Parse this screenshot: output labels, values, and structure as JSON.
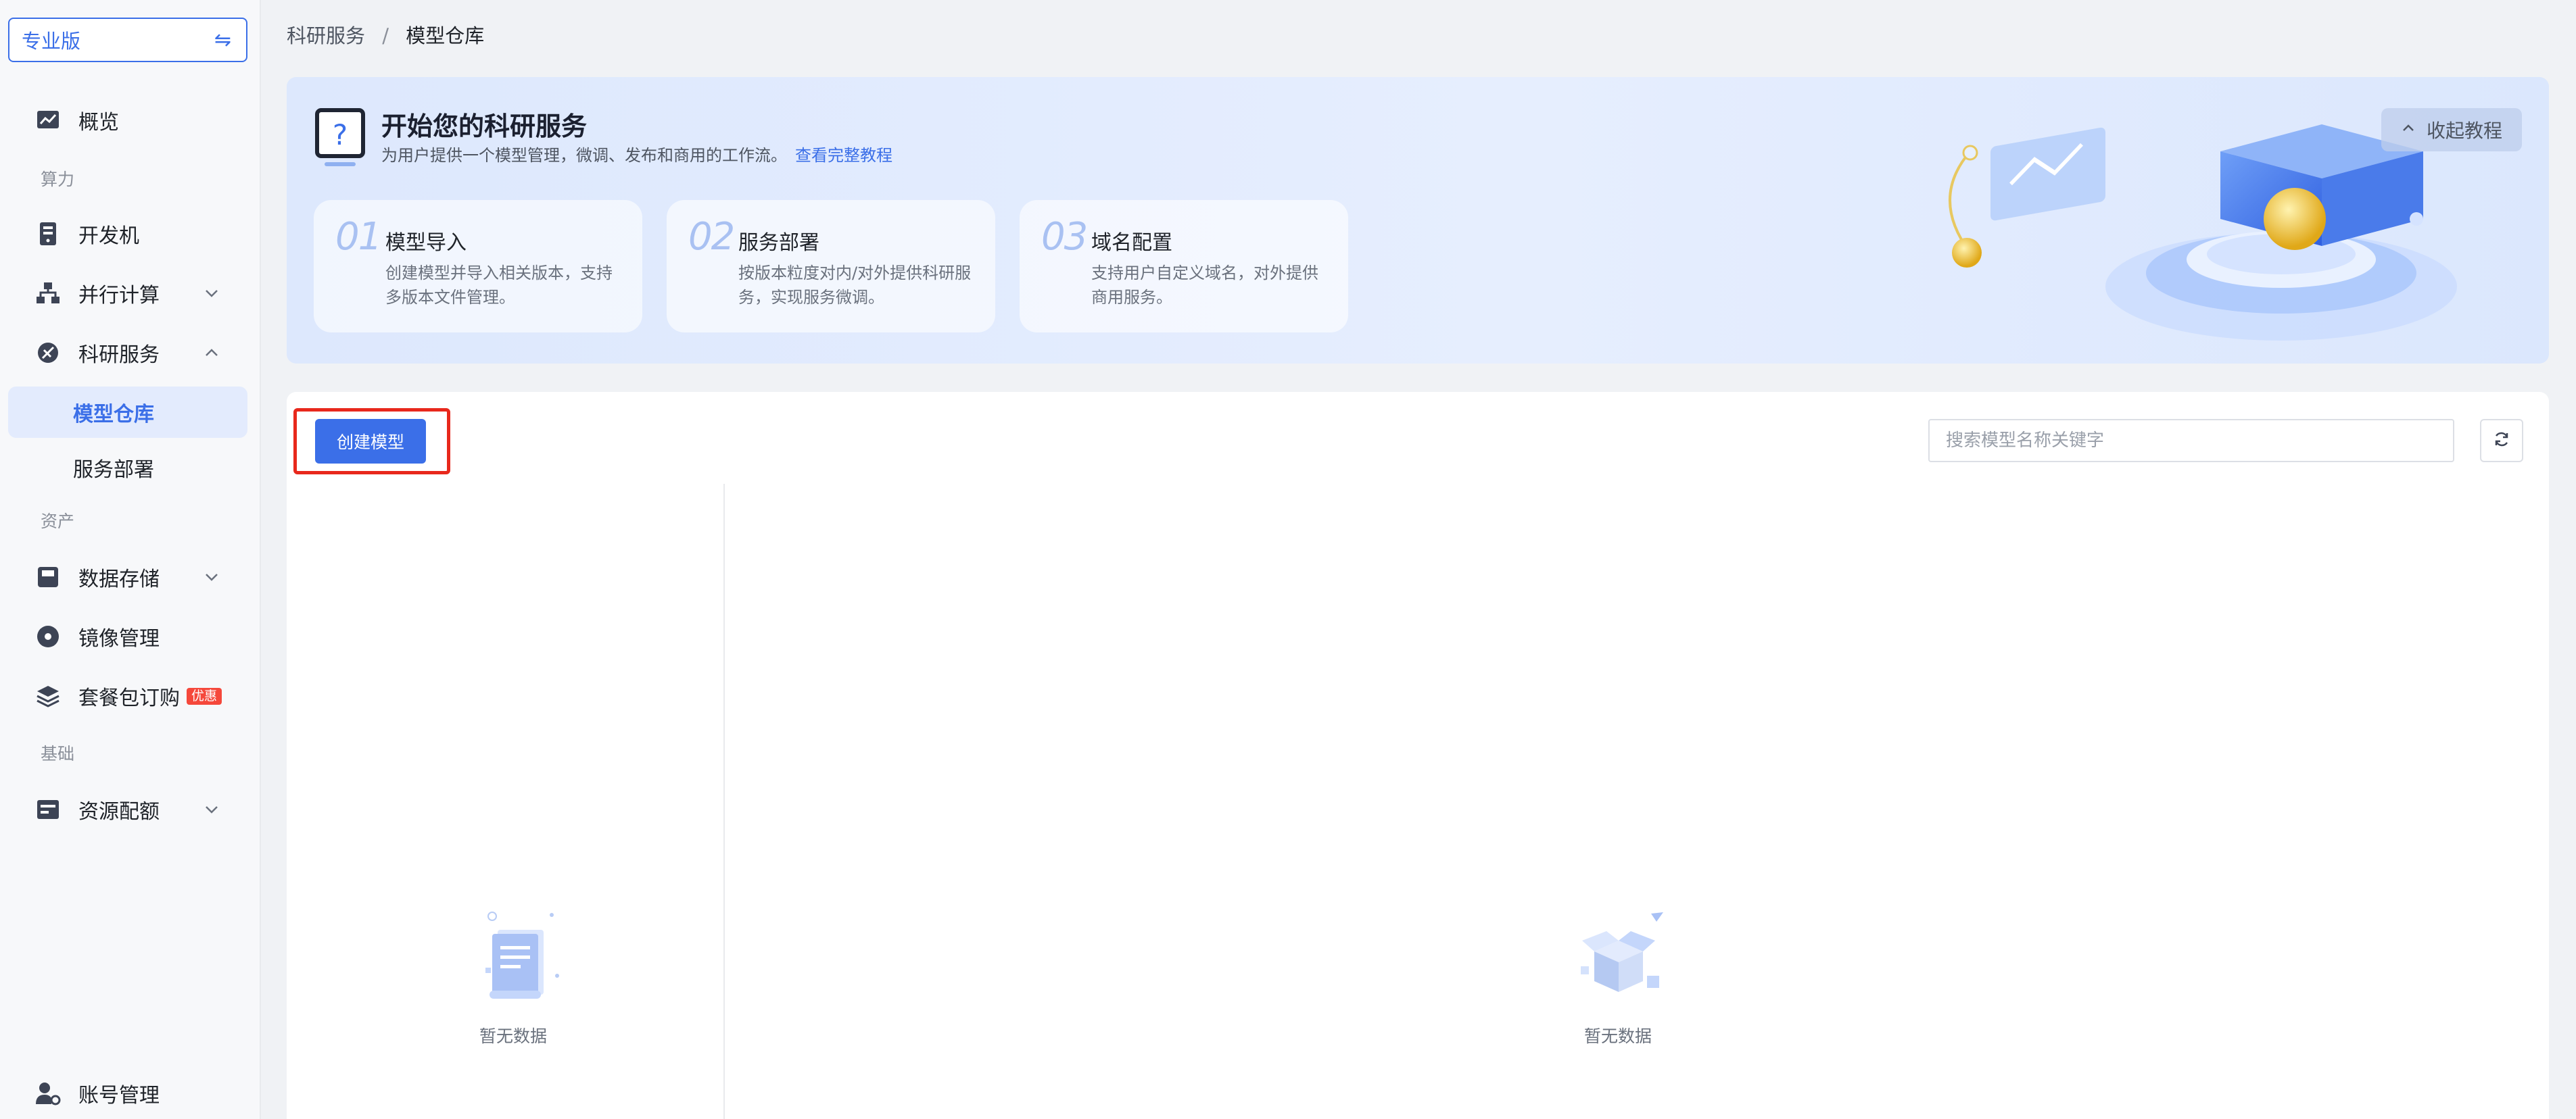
{
  "sidebar": {
    "edition": "专业版",
    "overview": "概览",
    "section_compute": "算力",
    "devmachine": "开发机",
    "parallel": "并行计算",
    "research": "科研服务",
    "model_repo": "模型仓库",
    "service_deploy": "服务部署",
    "section_assets": "资产",
    "data_storage": "数据存储",
    "image_mgmt": "镜像管理",
    "package_order": "套餐包订购",
    "package_badge": "优惠",
    "section_basic": "基础",
    "resource_quota": "资源配额",
    "account_mgmt": "账号管理"
  },
  "breadcrumb": {
    "parent": "科研服务",
    "separator": "/",
    "current": "模型仓库"
  },
  "banner": {
    "title": "开始您的科研服务",
    "subtitle": "为用户提供一个模型管理，微调、发布和商用的工作流。",
    "link": "查看完整教程",
    "collapse": "收起教程",
    "steps": [
      {
        "num": "01",
        "title": "模型导入",
        "desc": "创建模型并导入相关版本，支持多版本文件管理。"
      },
      {
        "num": "02",
        "title": "服务部署",
        "desc": "按版本粒度对内/对外提供科研服务，实现服务微调。"
      },
      {
        "num": "03",
        "title": "域名配置",
        "desc": "支持用户自定义域名，对外提供商用服务。"
      }
    ]
  },
  "content": {
    "create_button": "创建模型",
    "search_placeholder": "搜索模型名称关键字",
    "empty_left": "暂无数据",
    "empty_right": "暂无数据"
  },
  "colors": {
    "primary": "#3b6fe8",
    "highlight": "#e8281c",
    "badge": "#f5483b"
  }
}
